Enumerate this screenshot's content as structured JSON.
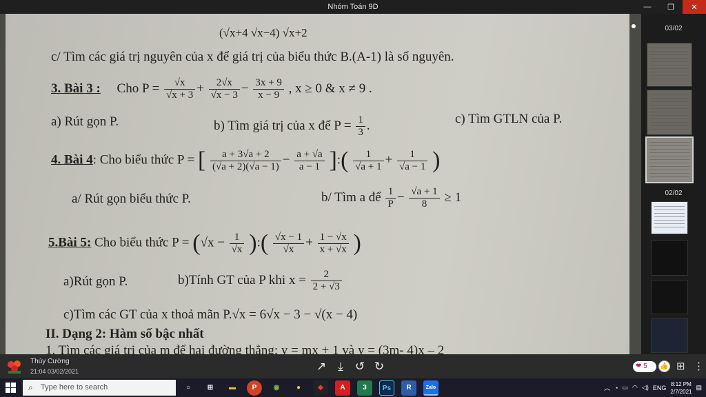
{
  "window": {
    "title": "Nhóm Toán 9D",
    "minimize": "—",
    "maximize": "❐",
    "close": "✕"
  },
  "doc": {
    "line0_expr": "(√x+4   √x−4)   √x+2",
    "line1": "c/ Tìm các giá trị nguyên của x để giá trị của biểu thức B.(A-1) là số nguyên.",
    "bai3_label": "3. Bài 3 :",
    "bai3_lead": "Cho P =",
    "bai3_f1": [
      "√x",
      "√x + 3"
    ],
    "bai3_f2": [
      "2√x",
      "√x − 3"
    ],
    "bai3_f3": [
      "3x + 9",
      "x − 9"
    ],
    "bai3_cond": ", x ≥ 0 & x ≠ 9 .",
    "bai3_a": "a) Rút gọn P.",
    "bai3_b": "b) Tìm giá trị của x để P =",
    "bai3_b_frac": [
      "1",
      "3"
    ],
    "bai3_c": "c) Tìm GTLN của P.",
    "bai4_label": "4. Bài 4",
    "bai4_lead": ": Cho biểu thức P =",
    "bai4_f1": [
      "a + 3√a + 2",
      "(√a + 2)(√a − 1)"
    ],
    "bai4_f2": [
      "a + √a",
      "a − 1"
    ],
    "bai4_f3": [
      "1",
      "√a + 1"
    ],
    "bai4_f4": [
      "1",
      "√a − 1"
    ],
    "bai4_a": "a/ Rút gọn biểu thức P.",
    "bai4_b": "b/ Tìm a để",
    "bai4_b_f1": [
      "1",
      "P"
    ],
    "bai4_b_f2": [
      "√a + 1",
      "8"
    ],
    "bai4_b_tail": "≥ 1",
    "bai5_label": "5.Bài 5:",
    "bai5_lead": "Cho biểu thức P =",
    "bai5_expr1": "√x −",
    "bai5_f1": [
      "1",
      "√x"
    ],
    "bai5_f2": [
      "√x − 1",
      "√x"
    ],
    "bai5_f3": [
      "1 − √x",
      "x + √x"
    ],
    "bai5_a": "a)Rút gọn P.",
    "bai5_b": "b)Tính GT của P khi x =",
    "bai5_b_frac": [
      "2",
      "2 + √3"
    ],
    "bai5_c": "c)Tìm các GT của x thoả mãn P.√x = 6√x − 3 − √(x − 4)",
    "section2": "II. Dạng 2: Hàm số bậc nhất",
    "last": "1. Tìm các giá trị của m để hai đường thẳng: y = mx + 1 và y = (3m- 4)x – 2"
  },
  "sidebar": {
    "page1": "03/02",
    "page2": "02/02"
  },
  "bottom": {
    "user": "Thùy Cường",
    "time": "21:04 03/02/2021",
    "likes": "5",
    "tools": [
      "↗",
      "⤓",
      "↺",
      "↻"
    ]
  },
  "taskbar": {
    "search_placeholder": "Type here to search",
    "icons": [
      "○",
      "⊞",
      "▬",
      "P",
      "◉",
      "●",
      "◆",
      "A",
      "3",
      "Ps",
      "R",
      "Zalo"
    ],
    "lang": "ENG",
    "clock_time": "8:12 PM",
    "clock_date": "2/7/2021",
    "colors": {
      "taskbar": "#1b1b2a",
      "powerpoint": "#d04423",
      "chrome": "#3c8d3c",
      "acrobat": "#d21f21",
      "excel3": "#1f7a4d",
      "ps": "#0c2a4e",
      "r": "#2a5fa8",
      "zalo": "#1f6feb"
    }
  }
}
